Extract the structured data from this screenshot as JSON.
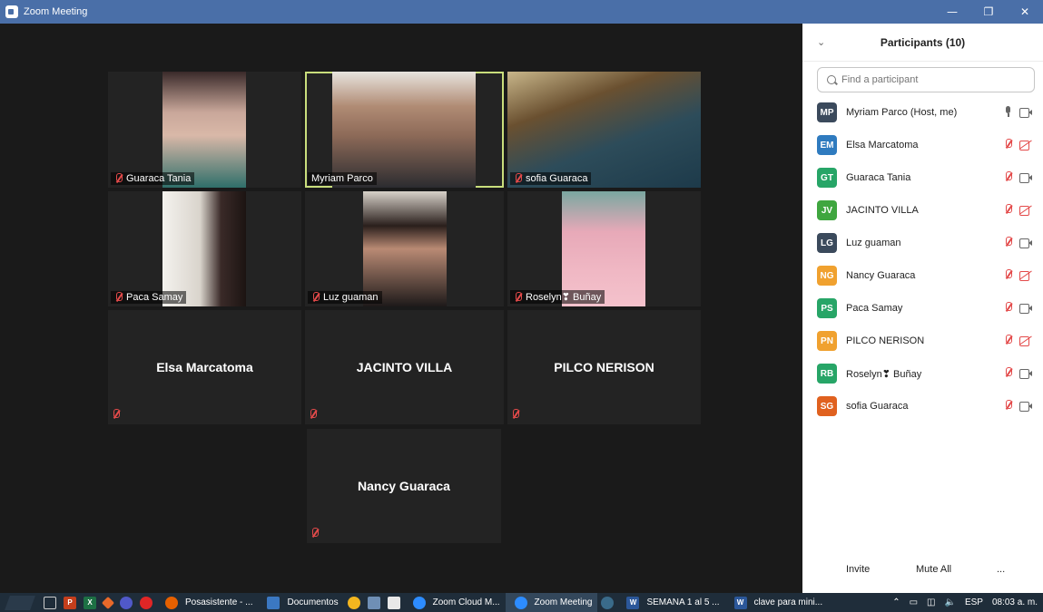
{
  "window": {
    "title": "Zoom Meeting",
    "minimize": "—",
    "restore": "❐",
    "close": "✕"
  },
  "video_tiles": [
    {
      "name": "Guaraca Tania",
      "muted": true,
      "video": true
    },
    {
      "name": "Myriam Parco",
      "muted": false,
      "video": true,
      "active_speaker": true
    },
    {
      "name": "sofia Guaraca",
      "muted": true,
      "video": true
    },
    {
      "name": "Paca Samay",
      "muted": true,
      "video": true
    },
    {
      "name": "Luz guaman",
      "muted": true,
      "video": true
    },
    {
      "name": "Roselyn❣ Buñay",
      "muted": true,
      "video": true
    },
    {
      "name": "Elsa Marcatoma",
      "muted": true,
      "video": false
    },
    {
      "name": "JACINTO VILLA",
      "muted": true,
      "video": false
    },
    {
      "name": "PILCO NERISON",
      "muted": true,
      "video": false
    },
    {
      "name": "Nancy Guaraca",
      "muted": true,
      "video": false
    }
  ],
  "panel": {
    "title": "Participants (10)",
    "search_placeholder": "Find a participant",
    "participants": [
      {
        "initials": "MP",
        "name": "Myriam Parco (Host, me)",
        "color": "#3b4a5c",
        "mic": "on",
        "cam": "on"
      },
      {
        "initials": "EM",
        "name": "Elsa Marcatoma",
        "color": "#2f7bbf",
        "mic": "muted",
        "cam": "off"
      },
      {
        "initials": "GT",
        "name": "Guaraca Tania",
        "color": "#27a567",
        "mic": "muted",
        "cam": "on"
      },
      {
        "initials": "JV",
        "name": "JACINTO VILLA",
        "color": "#3fa63f",
        "mic": "muted",
        "cam": "off"
      },
      {
        "initials": "LG",
        "name": "Luz guaman",
        "color": "#3b4a5c",
        "mic": "muted",
        "cam": "on"
      },
      {
        "initials": "NG",
        "name": "Nancy Guaraca",
        "color": "#f0a12f",
        "mic": "muted",
        "cam": "off"
      },
      {
        "initials": "PS",
        "name": "Paca Samay",
        "color": "#27a567",
        "mic": "muted",
        "cam": "on"
      },
      {
        "initials": "PN",
        "name": "PILCO NERISON",
        "color": "#f0a12f",
        "mic": "muted",
        "cam": "off"
      },
      {
        "initials": "RB",
        "name": "Roselyn❣ Buñay",
        "color": "#27a567",
        "mic": "muted",
        "cam": "on"
      },
      {
        "initials": "SG",
        "name": "sofia Guaraca",
        "color": "#e0611f",
        "mic": "muted",
        "cam": "on"
      }
    ],
    "invite_label": "Invite",
    "mute_all_label": "Mute All",
    "more_label": "..."
  },
  "taskbar": {
    "items": [
      {
        "label": "Posasistente - ..."
      },
      {
        "label": "Documentos"
      },
      {
        "label": "Zoom Cloud M..."
      },
      {
        "label": "Zoom Meeting",
        "active": true
      },
      {
        "label": "SEMANA 1 al 5 ..."
      },
      {
        "label": "clave para mini..."
      }
    ],
    "language": "ESP",
    "time": "08:03 a. m."
  }
}
